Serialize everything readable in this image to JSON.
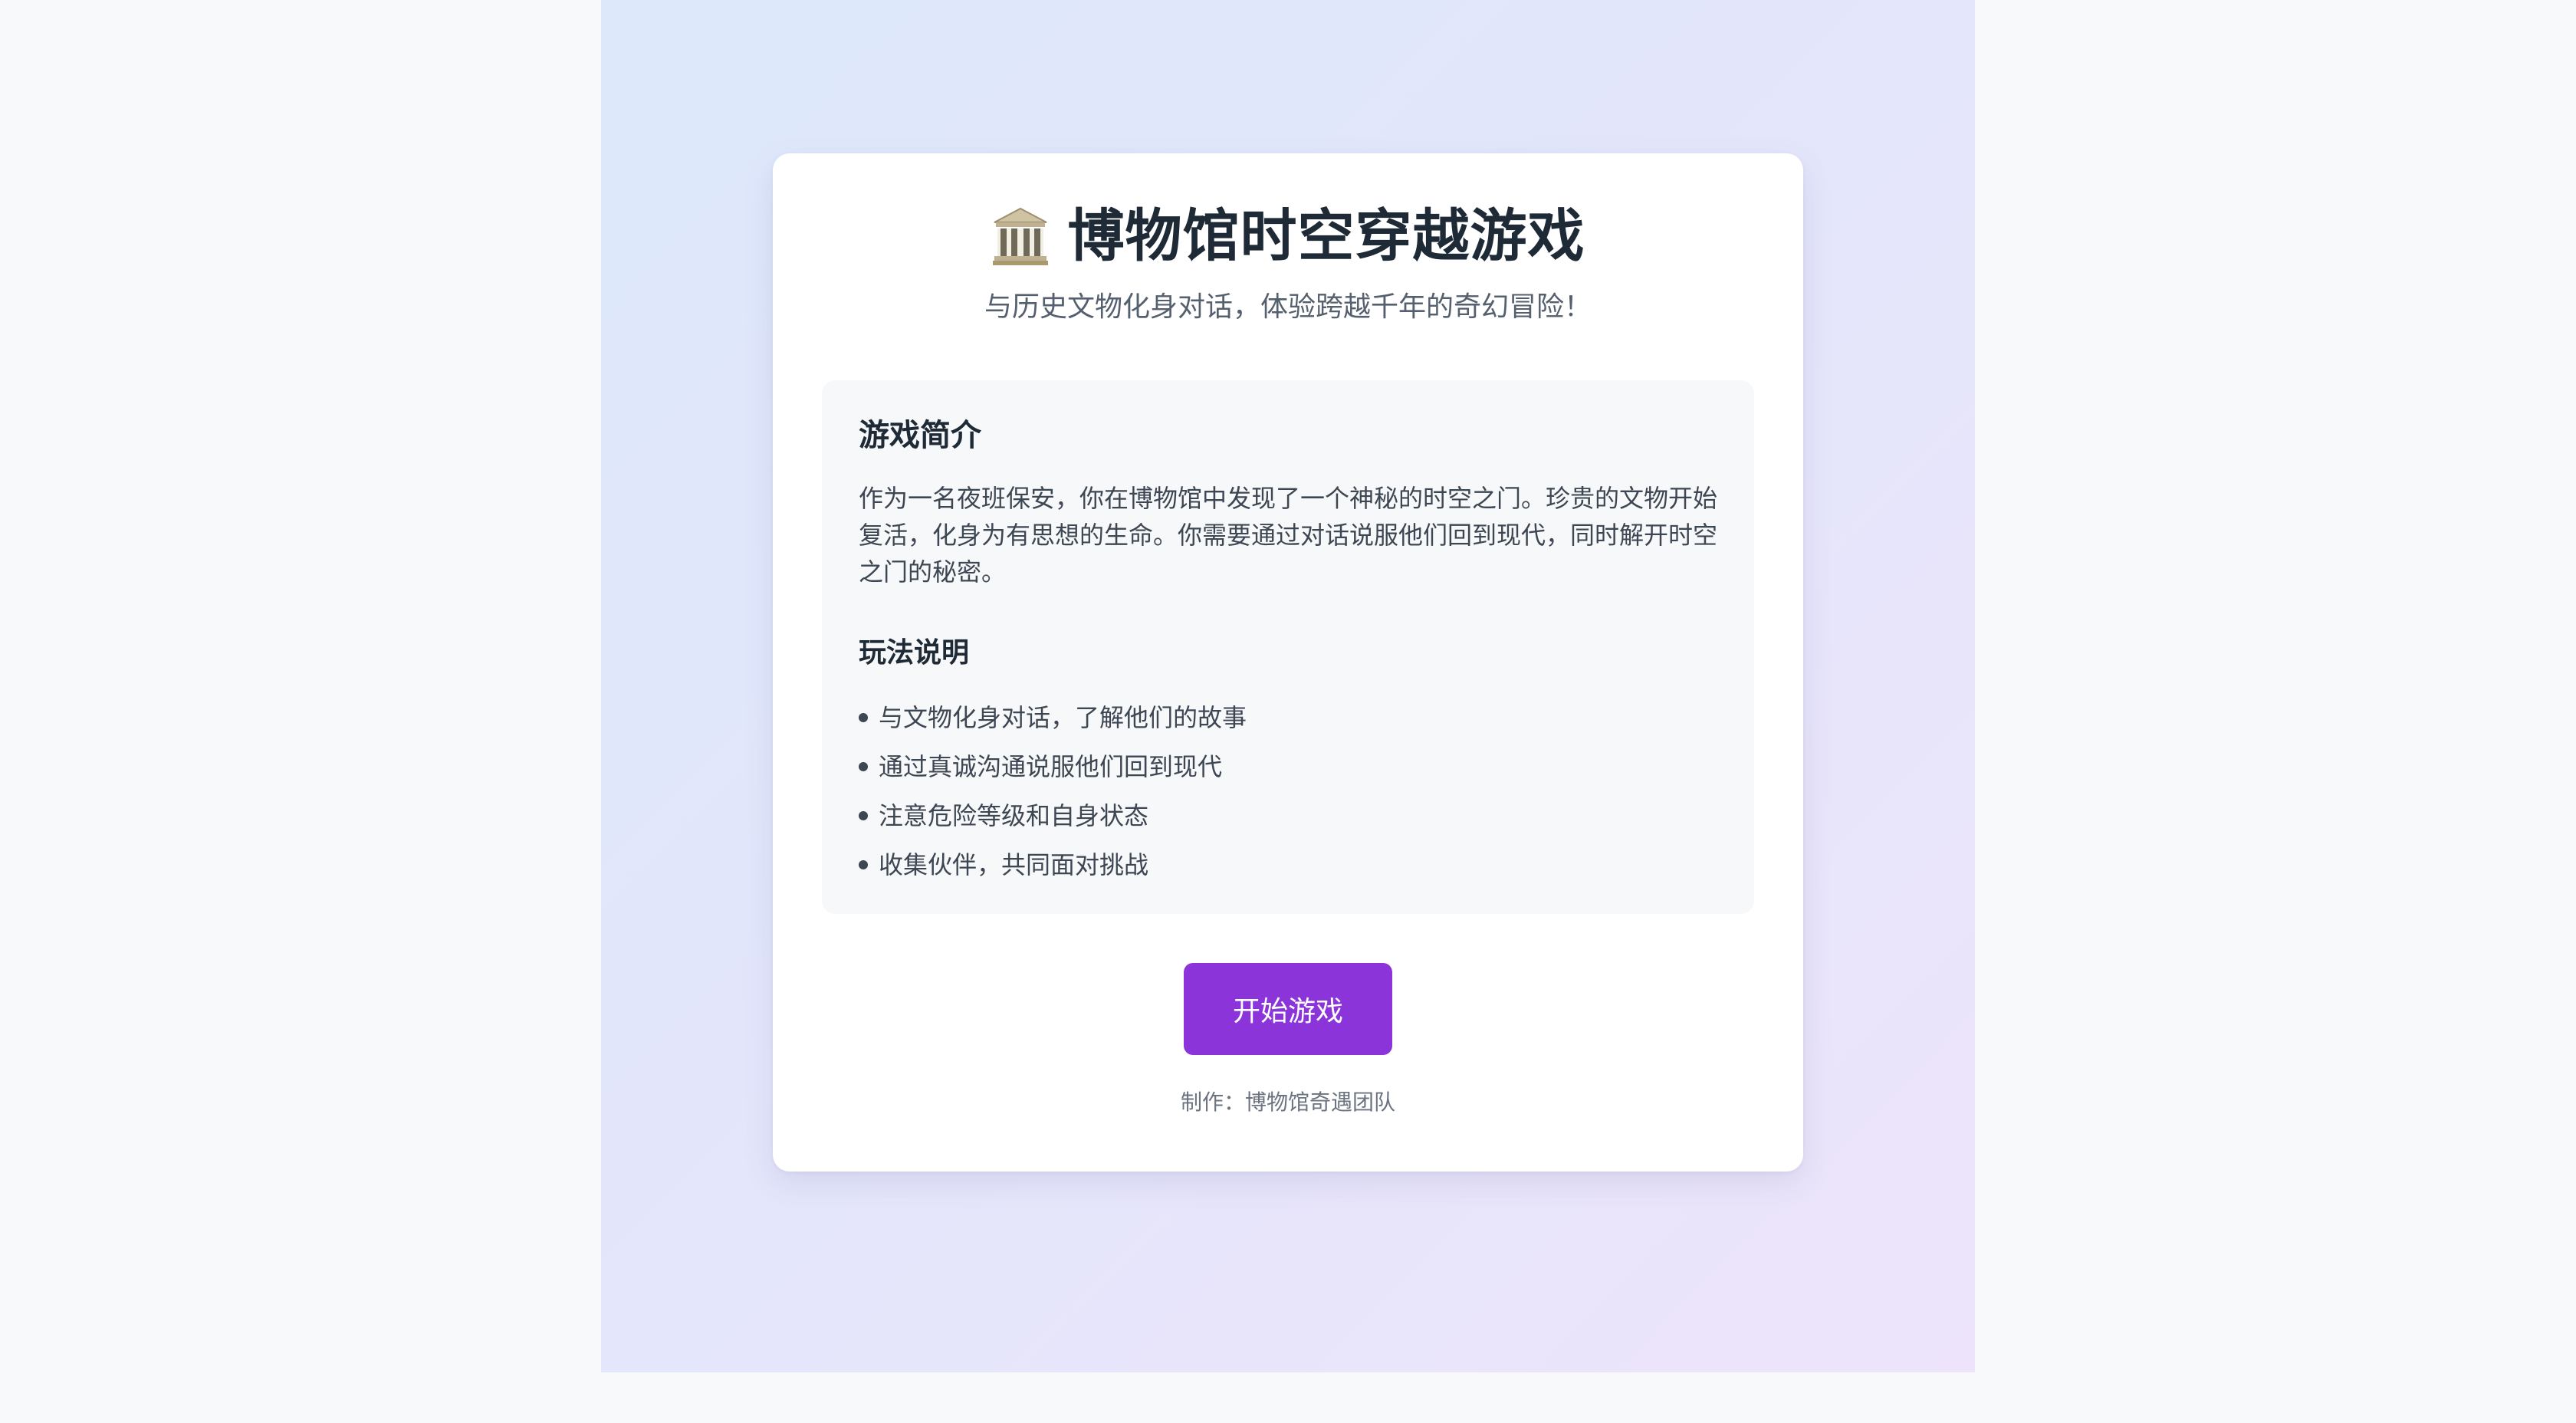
{
  "game": {
    "title": "博物馆时空穿越游戏",
    "title_icon": "museum-building-icon",
    "subtitle": "与历史文物化身对话，体验跨越千年的奇幻冒险！"
  },
  "intro": {
    "heading": "游戏简介",
    "text": "作为一名夜班保安，你在博物馆中发现了一个神秘的时空之门。珍贵的文物开始复活，化身为有思想的生命。你需要通过对话说服他们回到现代，同时解开时空之门的秘密。"
  },
  "rules": {
    "heading": "玩法说明",
    "items": [
      "与文物化身对话，了解他们的故事",
      "通过真诚沟通说服他们回到现代",
      "注意危险等级和自身状态",
      "收集伙伴，共同面对挑战"
    ]
  },
  "start_button": {
    "label": "开始游戏"
  },
  "credits": "制作：博物馆奇遇团队",
  "colors": {
    "accent": "#8a34d9",
    "title_text": "#1f2a37",
    "body_text": "#3d4653"
  }
}
